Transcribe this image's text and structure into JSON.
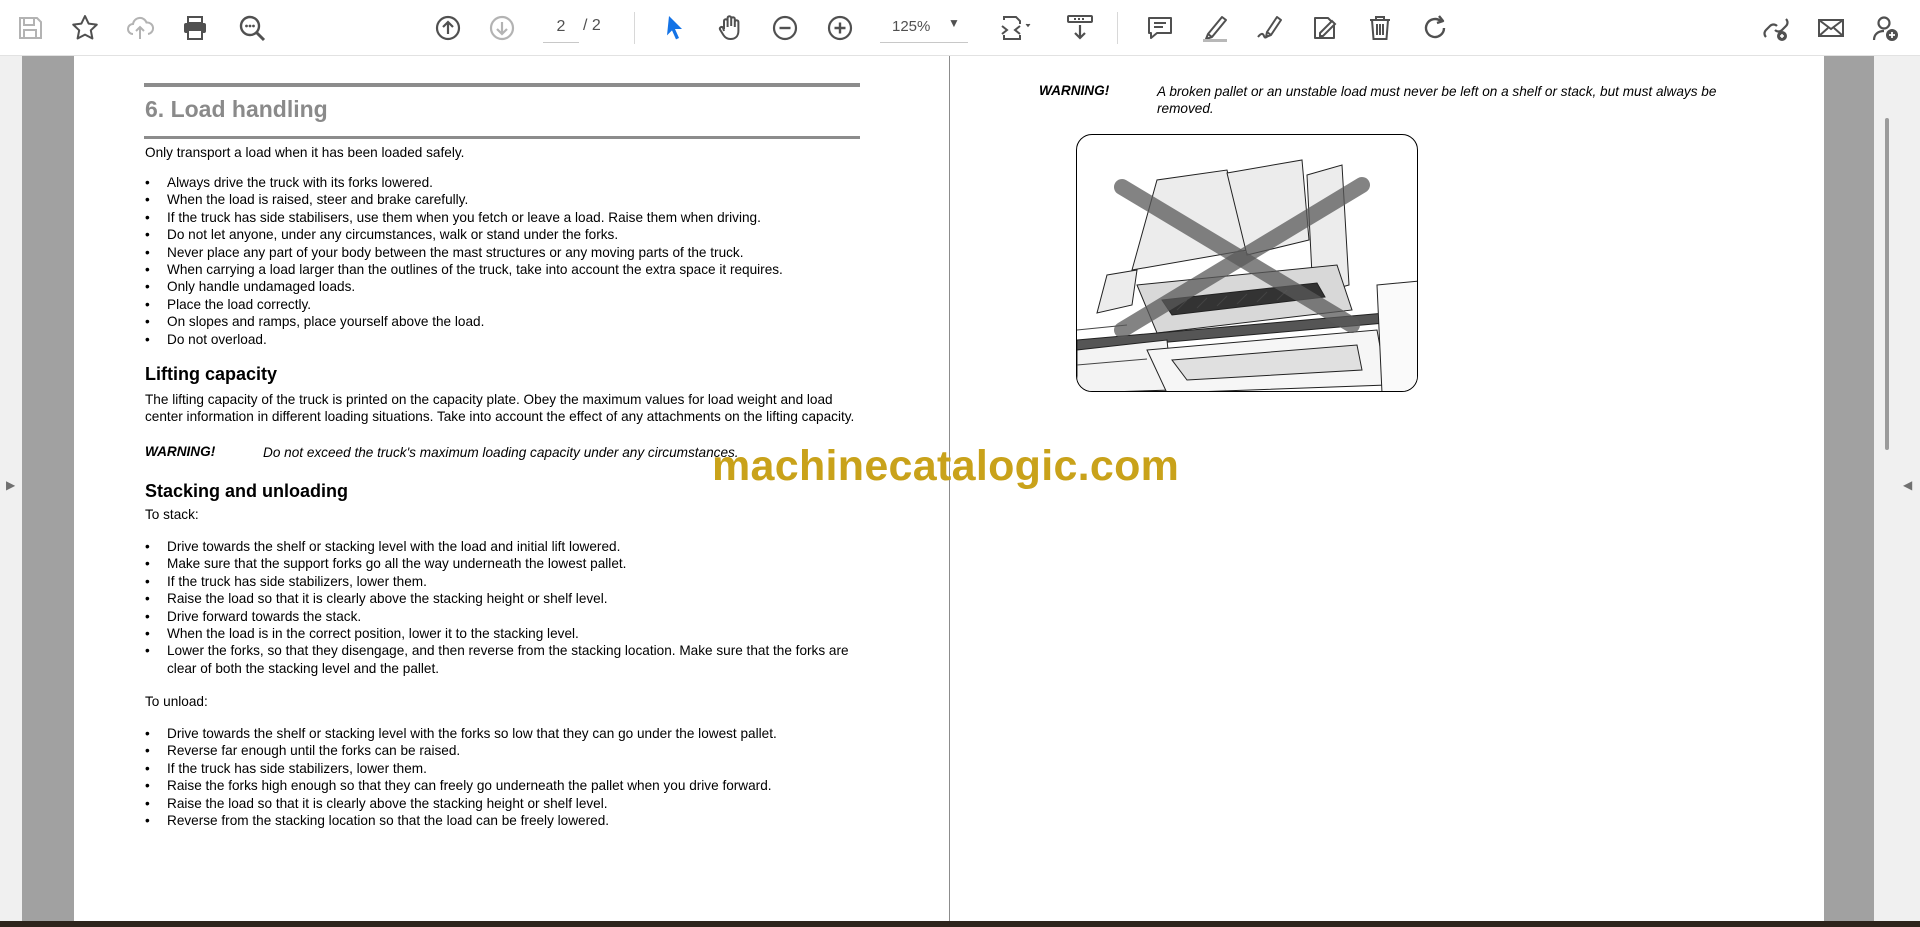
{
  "toolbar": {
    "current_page": "2",
    "total_pages": "/ 2",
    "zoom": "125%",
    "icons": [
      "save-icon",
      "bookmark-star-icon",
      "cloud-upload-icon",
      "print-icon",
      "search-zoom-icon",
      "page-up-icon",
      "page-down-icon",
      "select-cursor-icon",
      "hand-tool-icon",
      "zoom-out-icon",
      "zoom-in-icon",
      "fit-page-icon",
      "scroll-mode-icon",
      "comment-icon",
      "highlight-icon",
      "sign-icon",
      "stamp-icon",
      "delete-icon",
      "rotate-icon",
      "share-link-icon",
      "email-icon",
      "add-user-icon"
    ],
    "accent_color": "#1473e6"
  },
  "document": {
    "left_page": {
      "heading": "6. Load handling",
      "intro": "Only transport a load when it has been loaded safely.",
      "bullets_1": [
        "Always drive the truck with its forks lowered.",
        "When the load is raised, steer and brake carefully.",
        "If the truck has side stabilisers, use them when you fetch or leave a load. Raise them when driving.",
        "Do not let anyone, under any circumstances, walk or stand under the forks.",
        "Never place any part of your body between the mast structures or any moving parts of the truck.",
        "When carrying a load larger than the outlines of the truck, take into account the extra space it requires.",
        "Only handle undamaged loads.",
        "Place the load correctly.",
        "On slopes and ramps, place yourself above the load.",
        "Do not overload."
      ],
      "lifting_heading": "Lifting capacity",
      "lifting_text": "The lifting capacity of the truck is printed on the capacity plate. Obey the maximum values for load weight and load center information in different loading situations. Take into account the effect of any attachments on the lifting capacity.",
      "warning_label": "WARNING!",
      "warning_text": "Do not exceed the truck's maximum loading capacity under any circumstances.",
      "stacking_heading": "Stacking and unloading",
      "to_stack": "To stack:",
      "bullets_stack": [
        "Drive towards the shelf or stacking level with the load and initial lift lowered.",
        "Make sure that the support forks go all the way underneath the lowest pallet.",
        "If the truck has side stabilizers, lower them.",
        "Raise the load so that it is clearly above the stacking height or shelf level.",
        "Drive forward towards the stack.",
        "When the load is in the correct position, lower it to the stacking level.",
        "Lower the forks, so that they disengage, and then reverse from the stacking location. Make sure that the forks are clear of both the stacking level and the pallet."
      ],
      "to_unload": "To unload:",
      "bullets_unload": [
        "Drive towards the shelf or stacking level with the forks so low that they can go under the lowest pallet.",
        "Reverse far enough until the forks can be raised.",
        "If the truck has side stabilizers, lower them.",
        "Raise the forks high enough so that they can freely go underneath the pallet when you drive forward.",
        "Raise the load so that it is clearly above the stacking height or shelf level.",
        "Reverse from the stacking location so that the load can be freely lowered."
      ]
    },
    "right_page": {
      "warning_label": "WARNING!",
      "warning_text": "A broken pallet or an unstable load must never be left on a shelf or stack, but must always be removed."
    }
  },
  "watermark": "machinecatalogic.com",
  "colors": {
    "watermark": "#c9a21a",
    "heading_gray": "#8a8a8a",
    "page_background": "#a1a1a1"
  }
}
